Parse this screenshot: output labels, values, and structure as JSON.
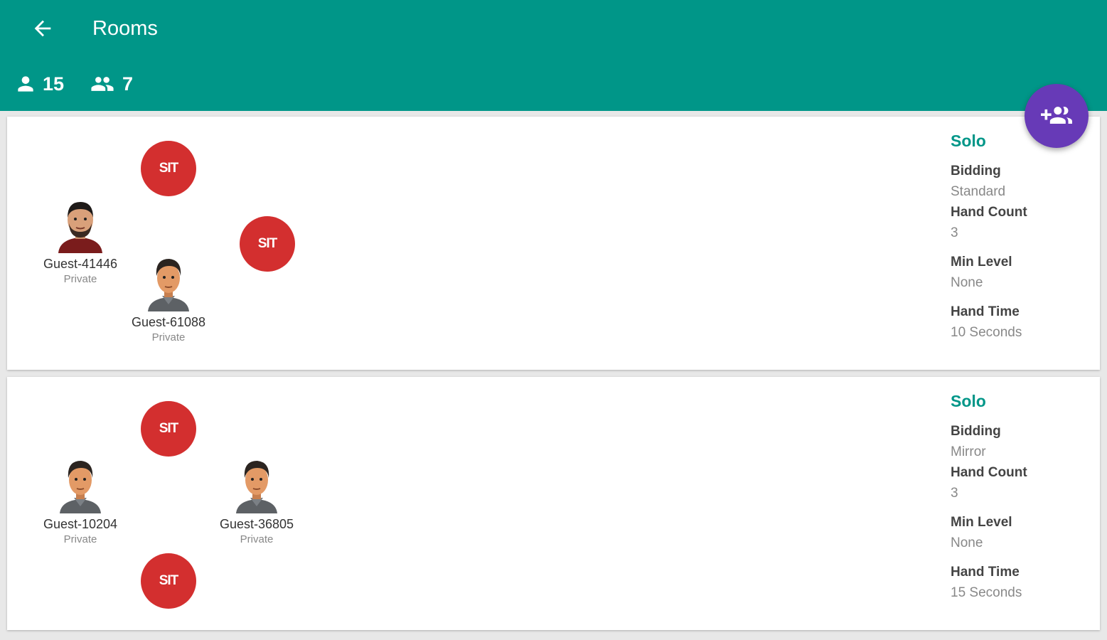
{
  "header": {
    "title": "Rooms",
    "players_count": "15",
    "rooms_count": "7"
  },
  "colors": {
    "appbar": "#009688",
    "fab": "#673ab7",
    "sit": "#d32f2f",
    "mode": "#009688"
  },
  "rooms": [
    {
      "sit_label": "SIT",
      "players": [
        {
          "name": "Guest-41446",
          "status": "Private",
          "avatar": "bearded-man-avatar"
        },
        {
          "name": "Guest-61088",
          "status": "Private",
          "avatar": "man-avatar"
        }
      ],
      "mode": "Solo",
      "bidding_label": "Bidding",
      "bidding": "Standard",
      "hand_count_label": "Hand Count",
      "hand_count": "3",
      "min_level_label": "Min Level",
      "min_level": "None",
      "hand_time_label": "Hand Time",
      "hand_time": "10 Seconds"
    },
    {
      "sit_label": "SIT",
      "players": [
        {
          "name": "Guest-10204",
          "status": "Private",
          "avatar": "man-avatar"
        },
        {
          "name": "Guest-36805",
          "status": "Private",
          "avatar": "man-avatar"
        }
      ],
      "mode": "Solo",
      "bidding_label": "Bidding",
      "bidding": "Mirror",
      "hand_count_label": "Hand Count",
      "hand_count": "3",
      "min_level_label": "Min Level",
      "min_level": "None",
      "hand_time_label": "Hand Time",
      "hand_time": "15 Seconds"
    }
  ]
}
